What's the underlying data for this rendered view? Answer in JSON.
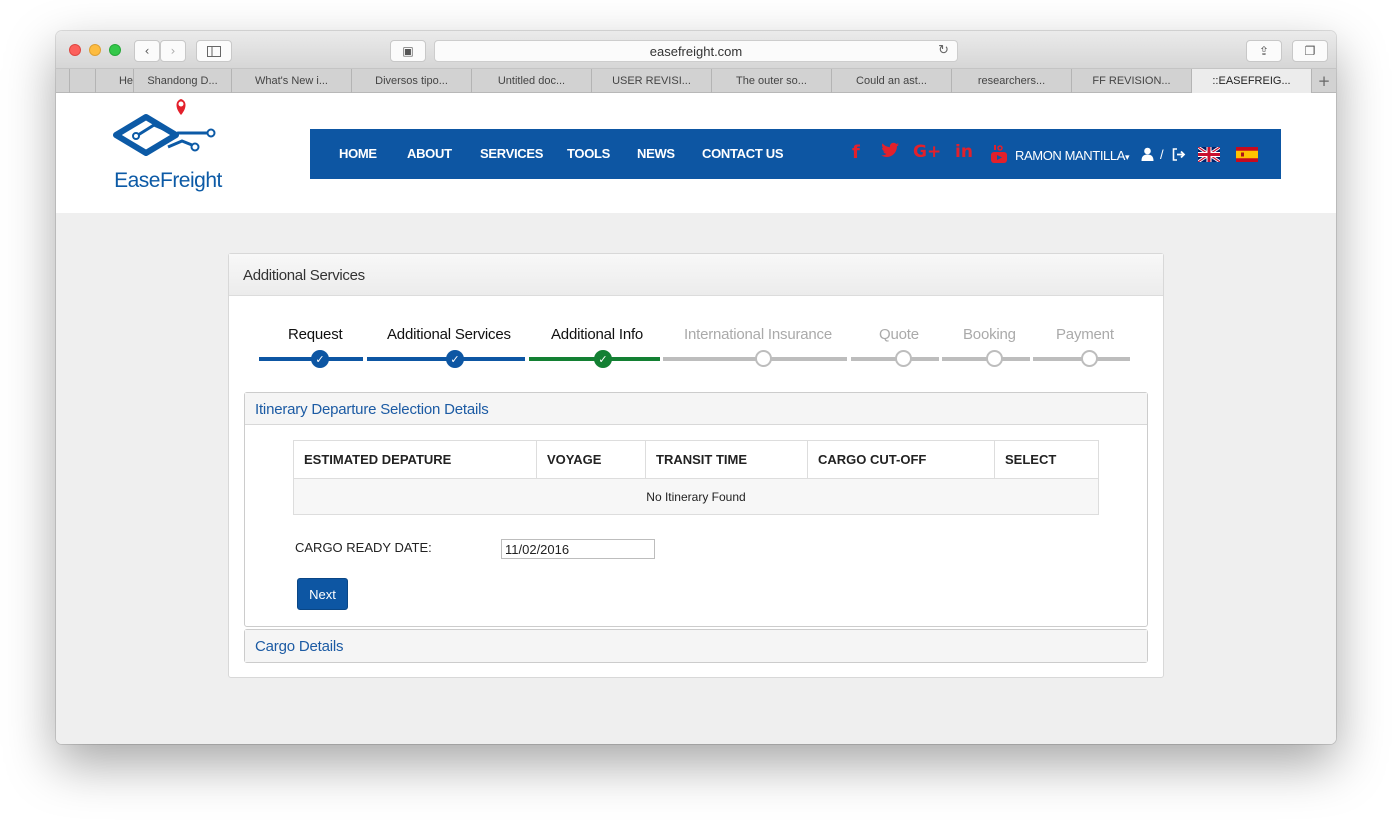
{
  "browser": {
    "url": "easefreight.com",
    "tabs": [
      "He",
      "Shandong D...",
      "What's New i...",
      "Diversos tipo...",
      "Untitled doc...",
      "USER REVISI...",
      "The outer so...",
      "Could an ast...",
      "researchers...",
      "FF REVISION...",
      "::EASEFREIG..."
    ],
    "active_tab_index": 10
  },
  "site": {
    "logo_text": "EaseFreight",
    "nav": [
      "HOME",
      "ABOUT",
      "SERVICES",
      "TOOLS",
      "NEWS",
      "CONTACT US"
    ],
    "social": [
      "f",
      "t",
      "G+",
      "in",
      "yt"
    ],
    "user_name": "RAMON MANTILLA",
    "user_separator": "/"
  },
  "panel": {
    "title": "Additional Services",
    "steps": [
      {
        "label": "Request",
        "state": "complete",
        "color": "#0d56a3"
      },
      {
        "label": "Additional Services",
        "state": "complete",
        "color": "#0d56a3"
      },
      {
        "label": "Additional Info",
        "state": "complete",
        "color": "#138033"
      },
      {
        "label": "International Insurance",
        "state": "pending",
        "color": "#bdbdbd"
      },
      {
        "label": "Quote",
        "state": "pending",
        "color": "#bdbdbd"
      },
      {
        "label": "Booking",
        "state": "pending",
        "color": "#bdbdbd"
      },
      {
        "label": "Payment",
        "state": "pending",
        "color": "#bdbdbd"
      }
    ],
    "itinerary": {
      "title": "Itinerary Departure Selection Details",
      "columns": [
        "ESTIMATED DEPATURE",
        "VOYAGE",
        "TRANSIT TIME",
        "CARGO CUT-OFF",
        "SELECT"
      ],
      "empty_message": "No Itinerary Found",
      "cargo_ready_label": "CARGO READY DATE:",
      "cargo_ready_value": "11/02/2016",
      "next_label": "Next"
    },
    "cargo_details": {
      "title": "Cargo Details"
    }
  },
  "colors": {
    "brand_blue": "#0d56a3",
    "social_red": "#e3202b",
    "step_green": "#138033",
    "pending_gray": "#bdbdbd"
  }
}
